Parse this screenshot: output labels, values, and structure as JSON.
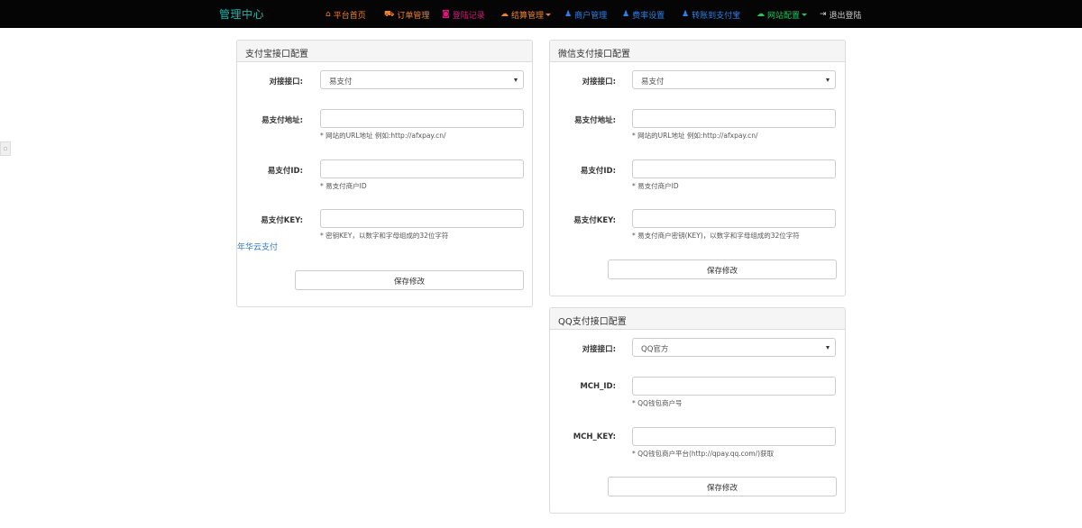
{
  "navbar": {
    "brand": "管理中心",
    "items": [
      {
        "label": "平台首页",
        "icon": "home-icon",
        "glyph": "⌂",
        "color": "#f0822d"
      },
      {
        "label": "订单管理",
        "icon": "cart-icon",
        "glyph": "🛒",
        "color": "#f0822d"
      },
      {
        "label": "登陆记录",
        "icon": "camera-icon",
        "glyph": "◙",
        "color": "#e0167f"
      },
      {
        "label": "结算管理",
        "icon": "cloud-icon",
        "glyph": "☁",
        "color": "#f0822d",
        "dropdown": true
      },
      {
        "label": "商户管理",
        "icon": "user-icon",
        "glyph": "♟",
        "color": "#2f80e6"
      },
      {
        "label": "费率设置",
        "icon": "user-icon",
        "glyph": "♟",
        "color": "#2f80e6"
      },
      {
        "label": "转账到支付宝",
        "icon": "user-icon",
        "glyph": "♟",
        "color": "#2f80e6"
      },
      {
        "label": "网站配置",
        "icon": "cloud-icon",
        "glyph": "☁",
        "color": "#22c55e",
        "dropdown": true
      },
      {
        "label": "退出登陆",
        "icon": "logout-icon",
        "glyph": "⇥",
        "color": "#cccccc"
      }
    ]
  },
  "alipay_panel": {
    "title": "支付宝接口配置",
    "interface_label": "对接接口:",
    "interface_value": "易支付",
    "url_label": "易支付地址:",
    "url_value": "",
    "url_help": "* 网站的URL地址 例如:http://afxpay.cn/",
    "id_label": "易支付ID:",
    "id_value": "",
    "id_help": "* 易支付商户ID",
    "key_label": "易支付KEY:",
    "key_value": "",
    "key_help": "* 密钥KEY，以数字和字母组成的32位字符",
    "link_text": "年华云支付",
    "save_label": "保存修改"
  },
  "wechat_panel": {
    "title": "微信支付接口配置",
    "interface_label": "对接接口:",
    "interface_value": "易支付",
    "url_label": "易支付地址:",
    "url_value": "",
    "url_help": "* 网站的URL地址 例如:http://afxpay.cn/",
    "id_label": "易支付ID:",
    "id_value": "",
    "id_help": "* 易支付商户ID",
    "key_label": "易支付KEY:",
    "key_value": "",
    "key_help": "* 易支付商户密钥(KEY)，以数字和字母组成的32位字符",
    "save_label": "保存修改"
  },
  "qq_panel": {
    "title": "QQ支付接口配置",
    "interface_label": "对接接口:",
    "interface_value": "QQ官方",
    "mchid_label": "MCH_ID:",
    "mchid_value": "",
    "mchid_help": "* QQ钱包商户号",
    "mchkey_label": "MCH_KEY:",
    "mchkey_value": "",
    "mchkey_help": "* QQ钱包商户平台(http://qpay.qq.com/)获取",
    "save_label": "保存修改"
  }
}
